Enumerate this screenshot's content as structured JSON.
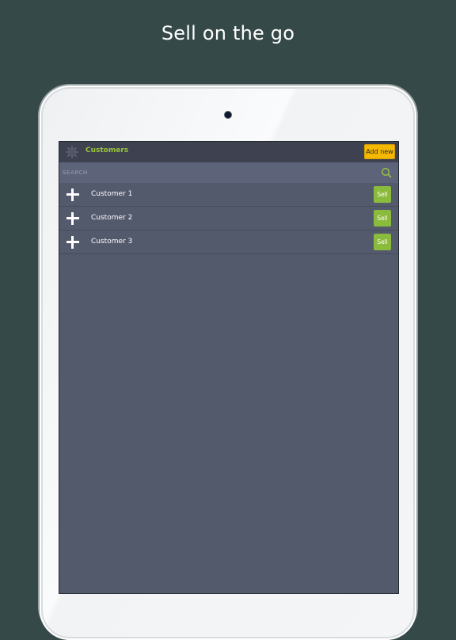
{
  "promo": {
    "headline": "Sell on the go"
  },
  "app": {
    "title": "Customers",
    "add_button": "Add new",
    "search": {
      "placeholder": "SEARCH",
      "value": ""
    },
    "customers": [
      {
        "name": "Customer 1",
        "sell_label": "Sell"
      },
      {
        "name": "Customer 2",
        "sell_label": "Sell"
      },
      {
        "name": "Customer 3",
        "sell_label": "Sell"
      }
    ]
  },
  "colors": {
    "background": "#354a48",
    "accent_green": "#9bc53d",
    "sell_button": "#8bbb3c",
    "add_button": "#f5b800",
    "topbar": "#3d4150",
    "list_bg": "#525a6b"
  },
  "icons": {
    "settings": "gear-icon",
    "search": "search-icon",
    "expand": "plus-icon"
  }
}
